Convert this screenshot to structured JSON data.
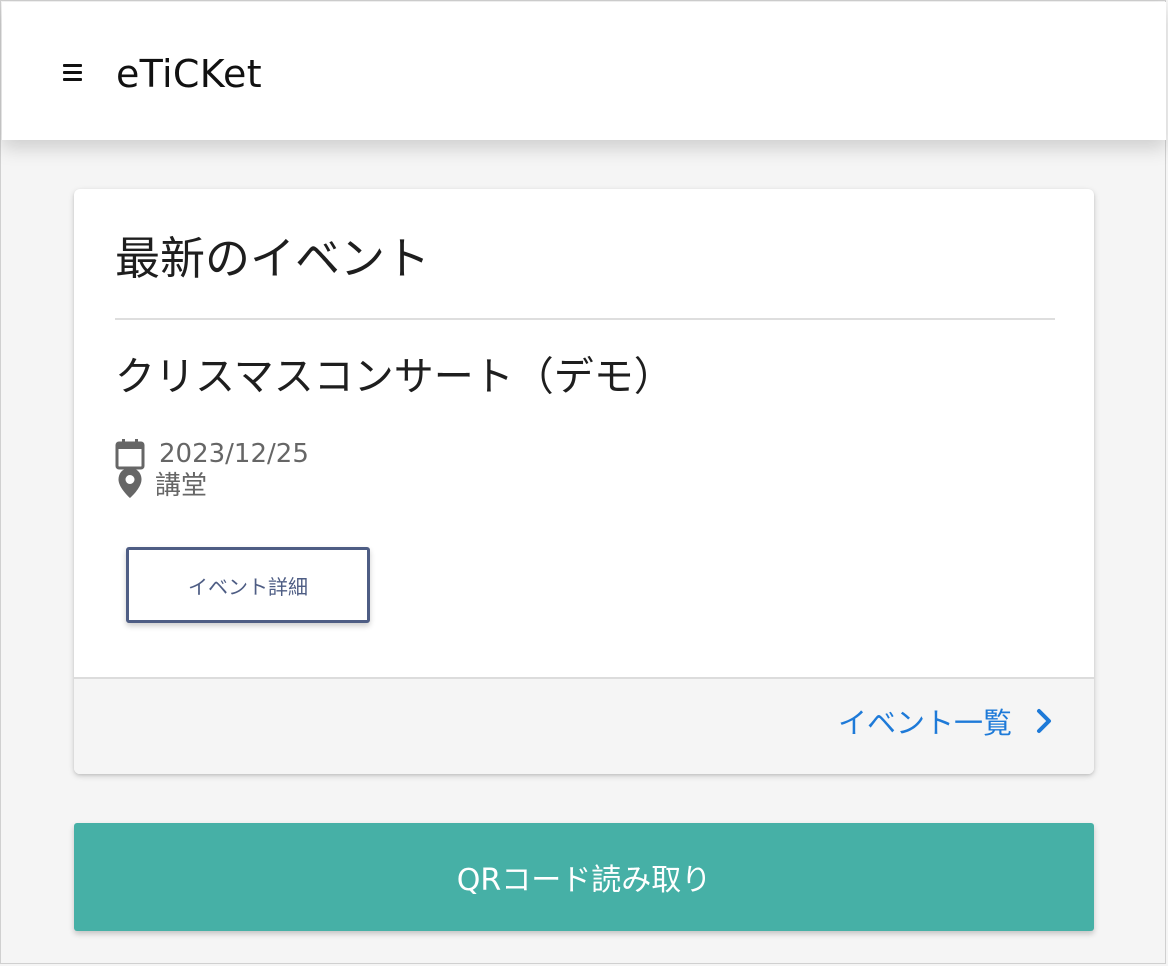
{
  "app_bar": {
    "menu_icon": "hamburger-menu-icon",
    "title": "eTiCKet"
  },
  "latest_events": {
    "heading": "最新のイベント",
    "event": {
      "title": "クリスマスコンサート（デモ）",
      "date": "2023/12/25",
      "date_icon": "calendar-icon",
      "location": "講堂",
      "location_icon": "map-pin-icon",
      "detail_button_label": "イベント詳細"
    },
    "footer": {
      "all_events_link": "イベント一覧",
      "link_icon": "chevron-right-icon"
    }
  },
  "qr_button": {
    "label": "QRコード読み取り"
  },
  "colors": {
    "accent_teal": "#46b0a6",
    "link_blue": "#1e7ad8",
    "button_border": "#4e5d84"
  }
}
